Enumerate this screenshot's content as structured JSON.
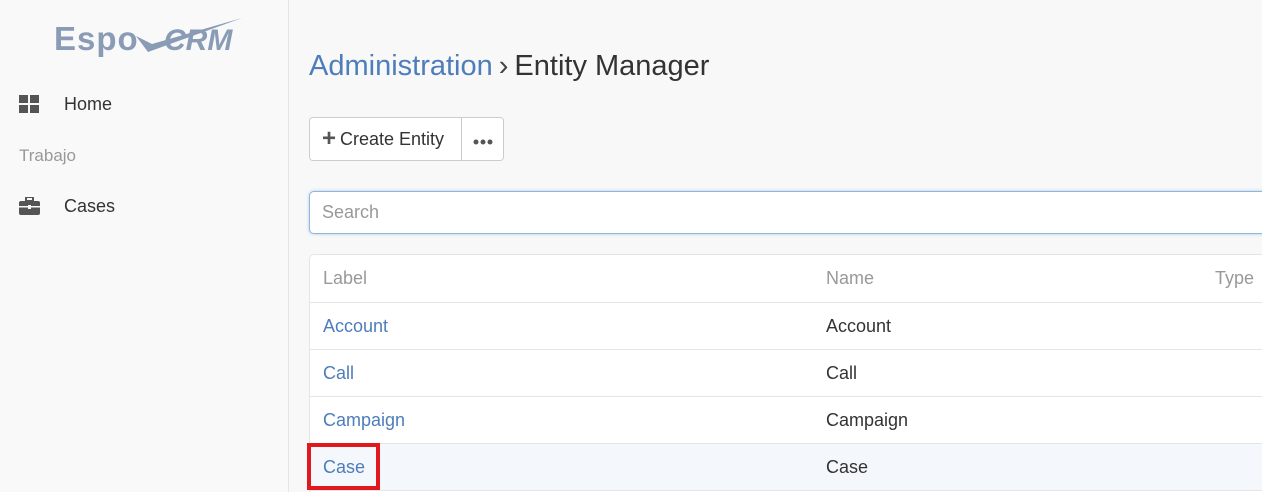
{
  "sidebar": {
    "logo_text": "EspoCRM",
    "items": [
      {
        "label": "Home",
        "icon": "grid-icon"
      },
      {
        "label": "Cases",
        "icon": "briefcase-icon"
      }
    ],
    "group_label": "Trabajo"
  },
  "breadcrumb": {
    "parent": "Administration",
    "separator": "›",
    "current": "Entity Manager"
  },
  "toolbar": {
    "create_label": "Create Entity",
    "create_icon": "plus-icon",
    "more_label": "•••",
    "more_icon": "ellipsis-icon"
  },
  "search": {
    "placeholder": "Search",
    "value": ""
  },
  "table": {
    "columns": [
      "Label",
      "Name",
      "Type"
    ],
    "rows": [
      {
        "label": "Account",
        "name": "Account"
      },
      {
        "label": "Call",
        "name": "Call"
      },
      {
        "label": "Campaign",
        "name": "Campaign"
      },
      {
        "label": "Case",
        "name": "Case"
      }
    ]
  },
  "colors": {
    "link": "#4d7dbb",
    "highlight_marker": "#e0191e",
    "logo": "#8a9bb5"
  }
}
